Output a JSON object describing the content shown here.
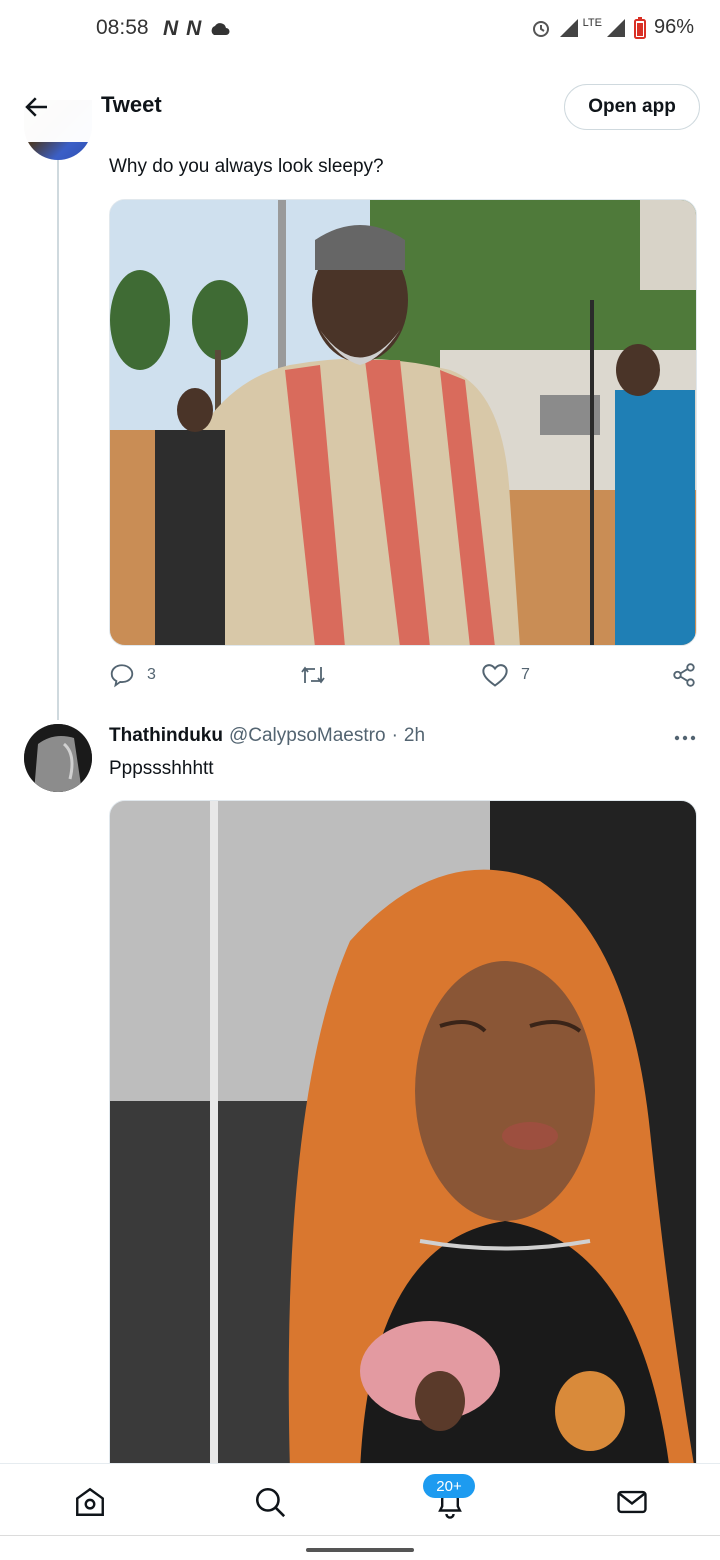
{
  "status_bar": {
    "time": "08:58",
    "notification_icons": [
      "n-icon",
      "n-icon",
      "cloud-icon"
    ],
    "network_label": "LTE",
    "battery": "96%"
  },
  "header": {
    "title": "Tweet",
    "open_app_label": "Open app"
  },
  "tweet1": {
    "text": "Why do you always look sleepy?",
    "image_alt": "Photo of a bearded man in a striped shirt",
    "reply_count": "3",
    "like_count": "7"
  },
  "tweet2": {
    "name": "Thathinduku",
    "handle": "@CalypsoMaestro",
    "separator": "·",
    "time": "2h",
    "text": "Pppssshhhtt",
    "image_alt": "Photo of a woman with long orange hair"
  },
  "bottom_nav": {
    "items": [
      "home-icon",
      "search-icon",
      "notifications-icon",
      "messages-icon"
    ],
    "notifications_badge": "20+"
  },
  "colors": {
    "accent": "#1d9bf0",
    "text": "#0f1419",
    "muted": "#536471"
  }
}
